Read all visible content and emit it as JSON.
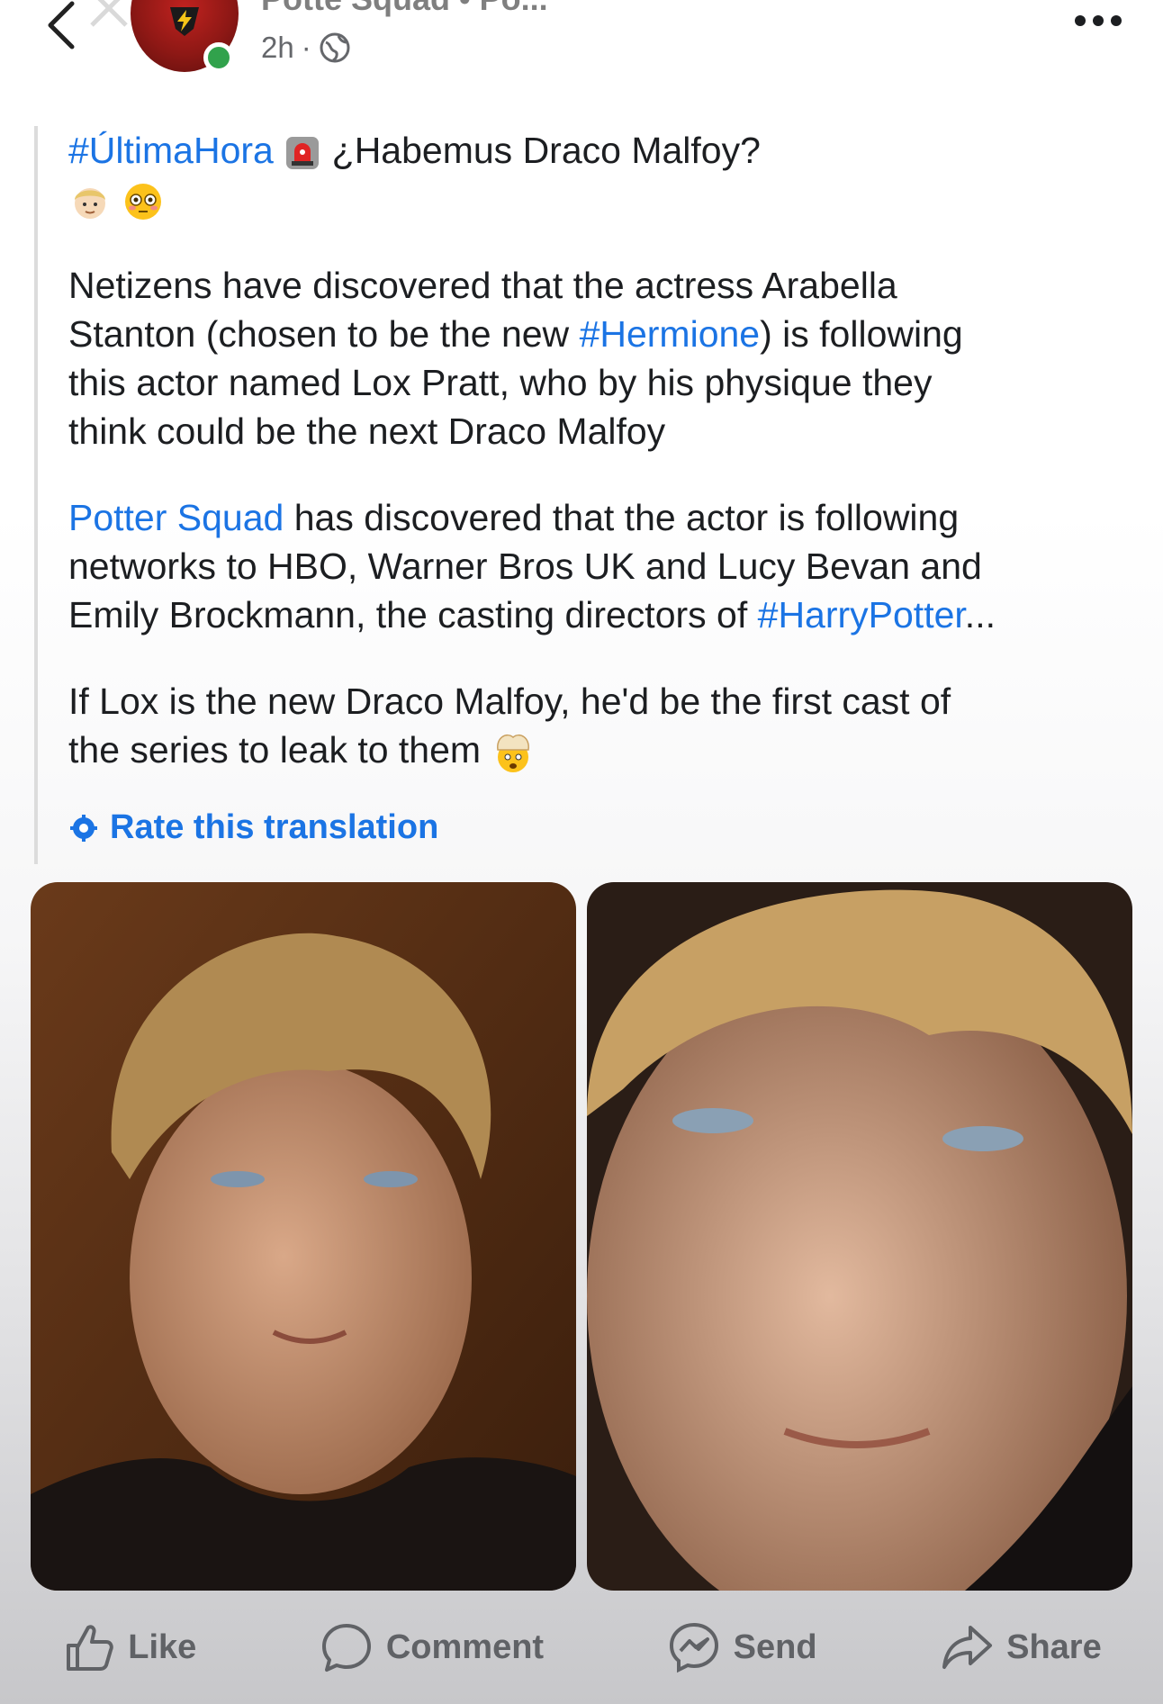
{
  "header": {
    "page_name": "Potte Squad • Po...",
    "time": "2h",
    "separator": "·"
  },
  "post": {
    "headline_tag": "#ÚltimaHora",
    "headline_text": "¿Habemus Draco Malfoy?",
    "p1": [
      "Netizens have discovered that the actress Arabella",
      "Stanton (chosen to be the new ",
      "#Hermione",
      ") is following",
      "this actor named Lox Pratt, who by his physique they",
      "think could be the next Draco Malfoy"
    ],
    "p2": [
      "Potter Squad",
      " has discovered that the actor is following",
      "networks to HBO, Warner Bros UK and Lucy Bevan and",
      "Emily Brockmann, the casting directors of ",
      "#HarryPotter",
      "..."
    ],
    "p3": [
      "If Lox is the new Draco Malfoy, he'd be the first cast of",
      "the series to leak to them"
    ],
    "rate_translation": "Rate this translation"
  },
  "actions": {
    "like": "Like",
    "comment": "Comment",
    "send": "Send",
    "share": "Share"
  },
  "icons": {
    "back": "chevron-left-icon",
    "close": "close-icon",
    "globe": "globe-icon",
    "more": "more-horizontal-icon",
    "siren": "siren-emoji",
    "person": "blond-person-emoji",
    "flushed": "flushed-face-emoji",
    "exploding": "exploding-head-emoji",
    "gear": "gear-icon"
  },
  "colors": {
    "link": "#1b74e4",
    "text": "#1c1e21",
    "muted": "#65676b",
    "online": "#31a24c"
  }
}
